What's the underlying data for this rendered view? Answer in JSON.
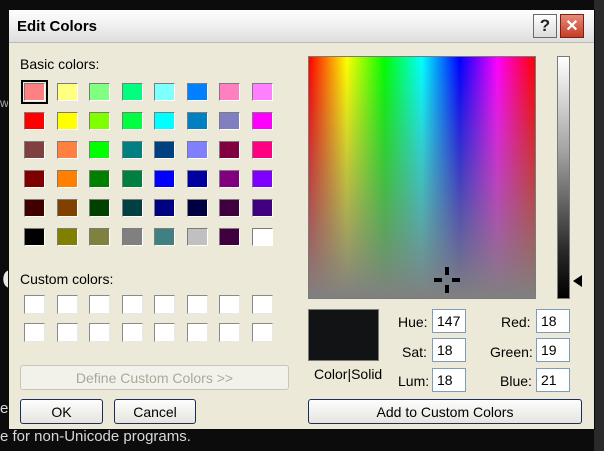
{
  "background": {
    "big_letter": "c",
    "side_text": "w",
    "side_text_2": "e",
    "status_text": "e for non-Unicode programs."
  },
  "dialog": {
    "title": "Edit Colors",
    "help_glyph": "?",
    "close_glyph": "✕"
  },
  "basic_colors": {
    "label": "Basic colors:",
    "rows": [
      [
        "#ff8080",
        "#ffff80",
        "#80ff80",
        "#00ff80",
        "#80ffff",
        "#0080ff",
        "#ff80c0",
        "#ff80ff"
      ],
      [
        "#ff0000",
        "#ffff00",
        "#80ff00",
        "#00ff40",
        "#00ffff",
        "#0080c0",
        "#8080c0",
        "#ff00ff"
      ],
      [
        "#804040",
        "#ff8040",
        "#00ff00",
        "#008080",
        "#004080",
        "#8080ff",
        "#800040",
        "#ff0080"
      ],
      [
        "#800000",
        "#ff8000",
        "#008000",
        "#008040",
        "#0000ff",
        "#0000a0",
        "#800080",
        "#8000ff"
      ],
      [
        "#400000",
        "#804000",
        "#004000",
        "#004040",
        "#000080",
        "#000040",
        "#400040",
        "#400080"
      ],
      [
        "#000000",
        "#808000",
        "#808040",
        "#808080",
        "#408080",
        "#c0c0c0",
        "#400040",
        "#ffffff"
      ]
    ],
    "selected": "0.0"
  },
  "custom_colors": {
    "label": "Custom colors:",
    "rows": 2,
    "cols": 8,
    "color": "#ffffff"
  },
  "buttons": {
    "define_custom": "Define Custom Colors >>",
    "ok": "OK",
    "cancel": "Cancel",
    "add_custom": "Add to Custom Colors"
  },
  "preview": {
    "label": "Color|Solid",
    "color": "#121315"
  },
  "fields": {
    "hue": {
      "label": "Hue:",
      "value": "147"
    },
    "sat": {
      "label": "Sat:",
      "value": "18"
    },
    "lum": {
      "label": "Lum:",
      "value": "18"
    },
    "red": {
      "label": "Red:",
      "value": "18"
    },
    "green": {
      "label": "Green:",
      "value": "19"
    },
    "blue": {
      "label": "Blue:",
      "value": "21"
    }
  }
}
